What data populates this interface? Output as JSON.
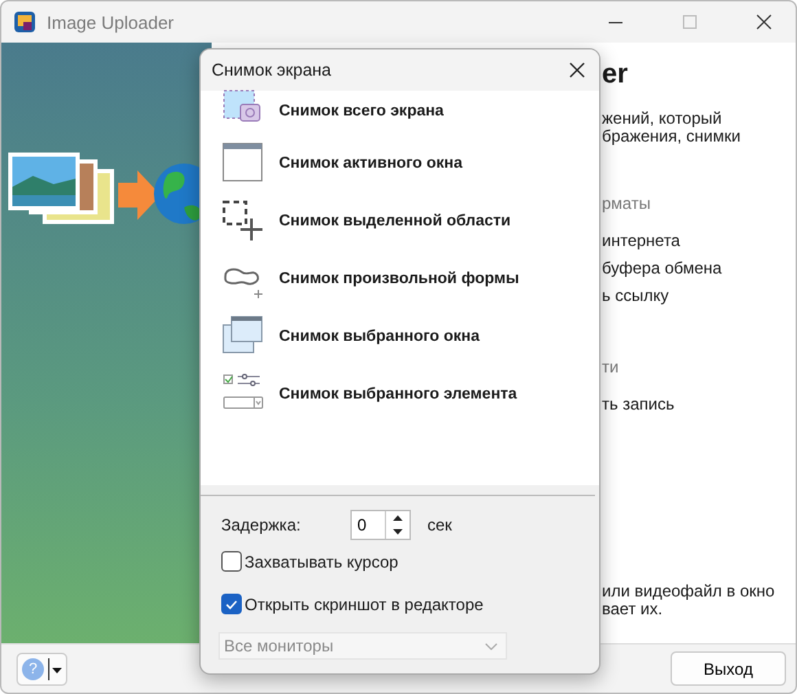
{
  "window": {
    "title": "Image Uploader"
  },
  "background_panel": {
    "heading": "er",
    "intro": [
      "жений, который",
      "бражения, снимки"
    ],
    "sections": [
      {
        "title": "рматы",
        "items": [
          "интернета",
          "буфера обмена",
          "ь ссылку"
        ]
      },
      {
        "title": "ти",
        "items": [
          "ть запись"
        ]
      }
    ],
    "footer_lines": [
      "или видеофайл в окно",
      "вает их."
    ]
  },
  "help_button": {
    "icon": "?"
  },
  "exit_button": "Выход",
  "dialog": {
    "title": "Снимок экрана",
    "items": [
      {
        "kind": "full_screen",
        "label": "Снимок всего экрана"
      },
      {
        "kind": "active_window",
        "label": "Снимок активного окна"
      },
      {
        "kind": "region",
        "label": "Снимок выделенной области"
      },
      {
        "kind": "freeform",
        "label": "Снимок произвольной формы"
      },
      {
        "kind": "selected_window",
        "label": "Снимок выбранного окна"
      },
      {
        "kind": "element",
        "label": "Снимок выбранного элемента"
      }
    ],
    "delay": {
      "label": "Задержка:",
      "value": "0",
      "unit": "сек"
    },
    "checkboxes": [
      {
        "label": "Захватывать курсор",
        "checked": false
      },
      {
        "label": "Открыть скриншот в редакторе",
        "checked": true
      }
    ],
    "monitor": {
      "value": "Все мониторы",
      "disabled": true
    }
  }
}
